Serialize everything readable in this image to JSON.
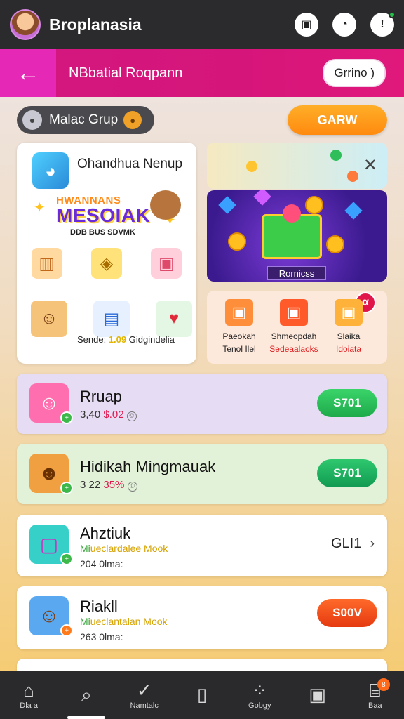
{
  "topbar": {
    "title": "Broplanasia",
    "icons": [
      "picture-icon",
      "clock-icon",
      "alert-icon"
    ]
  },
  "subbar": {
    "back_icon": "←",
    "title": "NBbatial Roqpann",
    "action": "Grrino )"
  },
  "group": {
    "label": "Malac Grup",
    "button": "GARW"
  },
  "promo": {
    "title": "Ohandhua Nenup",
    "banner_top": "HWANNANS",
    "banner_main": "MESOIAK",
    "banner_sub": "DDB BUS SDVMK",
    "caption_prefix": "Sende:",
    "caption_value": "1.09",
    "caption_suffix": "Gidgindelia"
  },
  "treasure": {
    "label": "Rornicss"
  },
  "rewards": {
    "badge": "α",
    "items": [
      {
        "l1": "Paeokah",
        "l2": "Tenol Ilel",
        "red": false
      },
      {
        "l1": "Shmeopdah",
        "l2": "Sedeaalaoks",
        "red": true
      },
      {
        "l1": "Slaika",
        "l2": "Idoiata",
        "red": true
      }
    ]
  },
  "rows": [
    {
      "name": "Rruap",
      "meta_a": "3,40",
      "meta_b": "$.02",
      "meta_c": "©",
      "button": "S701"
    },
    {
      "name": "Hidikah Mingmauak",
      "meta_a": "3 22",
      "meta_b": "35%",
      "meta_c": "©",
      "button": "S701"
    },
    {
      "name": "Ahztiuk",
      "sub_a": "Mi",
      "sub_b": "ueclardalee Mook",
      "sub2": "204 0lma:",
      "link": "GLI1"
    },
    {
      "name": "Riakll",
      "sub_a": "Mi",
      "sub_b": "ueclantalan Mook",
      "sub2": "263 0lma:",
      "button": "S00V"
    }
  ],
  "nav": [
    {
      "icon": "home-icon",
      "label": "Dla a"
    },
    {
      "icon": "search-icon",
      "label": ""
    },
    {
      "icon": "check-icon",
      "label": "Namtalc"
    },
    {
      "icon": "book-icon",
      "label": ""
    },
    {
      "icon": "grid-icon",
      "label": "Gobgy"
    },
    {
      "icon": "clipboard-icon",
      "label": ""
    },
    {
      "icon": "building-icon",
      "label": "Baa",
      "badge": "8"
    }
  ],
  "colors": {
    "magenta": "#d6157a",
    "green": "#2fbe5a",
    "orange": "#ff9a18",
    "red": "#ee4a1a"
  }
}
